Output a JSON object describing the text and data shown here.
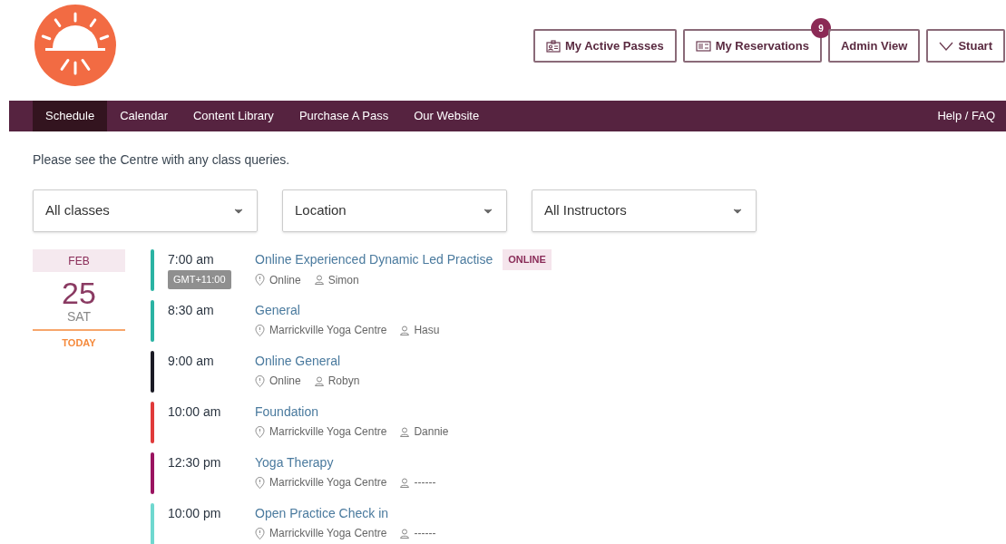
{
  "header_buttons": [
    {
      "kind": "passes",
      "label": "My Active Passes"
    },
    {
      "kind": "reservations",
      "label": "My Reservations",
      "badge": "9"
    },
    {
      "kind": "plain",
      "label": "Admin View"
    },
    {
      "kind": "user",
      "label": "Stuart"
    }
  ],
  "nav": {
    "items": [
      {
        "label": "Schedule",
        "selected": true
      },
      {
        "label": "Calendar",
        "selected": false
      },
      {
        "label": "Content Library",
        "selected": false
      },
      {
        "label": "Purchase A Pass",
        "selected": false
      },
      {
        "label": "Our Website",
        "selected": false
      }
    ],
    "help": "Help / FAQ"
  },
  "notice": "Please see the Centre with any class queries.",
  "filters": [
    {
      "value": "All classes"
    },
    {
      "value": "Location"
    },
    {
      "value": "All Instructors"
    }
  ],
  "date": {
    "month": "FEB",
    "day": "25",
    "weekday": "SAT",
    "today": "TODAY"
  },
  "classes": [
    {
      "time": "7:00 am",
      "timezone": "GMT+11:00",
      "name": "Online Experienced Dynamic Led Practise",
      "tag": "ONLINE",
      "location": "Online",
      "instructor": "Simon",
      "color": "#2ab3a3"
    },
    {
      "time": "8:30 am",
      "name": "General",
      "location": "Marrickville Yoga Centre",
      "instructor": "Hasu",
      "color": "#2ab3a3"
    },
    {
      "time": "9:00 am",
      "name": "Online General",
      "location": "Online",
      "instructor": "Robyn",
      "color": "#1a1a24"
    },
    {
      "time": "10:00 am",
      "name": "Foundation",
      "location": "Marrickville Yoga Centre",
      "instructor": "Dannie",
      "color": "#e03a3a"
    },
    {
      "time": "12:30 pm",
      "name": "Yoga Therapy",
      "location": "Marrickville Yoga Centre",
      "instructor": "------",
      "color": "#9a1360"
    },
    {
      "time": "10:00 pm",
      "name": "Open Practice Check in",
      "location": "Marrickville Yoga Centre",
      "instructor": "------",
      "color": "#6fd8cf"
    }
  ]
}
